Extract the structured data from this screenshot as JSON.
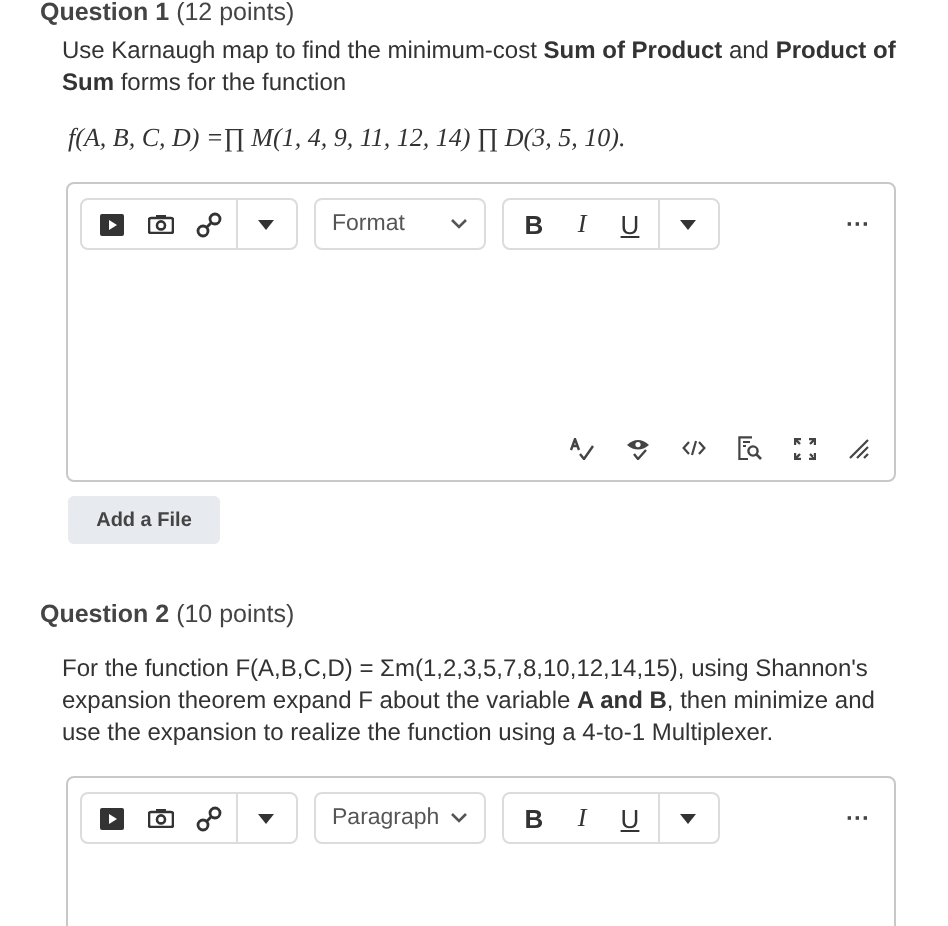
{
  "question_1": {
    "heading": "**Question 1** (12 points)",
    "prompt": "Use Karnaugh map to find the minimum-cost **Sum of Product** and **Product of Sum** forms for the function",
    "formula": "f(A, B, C, D) =∏ M(1, 4, 9, 11, 12, 14)  ∏ D(3, 5, 10).",
    "editor": {
      "format_label": "Format",
      "bold": "B",
      "italic": "I",
      "underline": "U",
      "more": "···",
      "show_status_bar": true
    },
    "add_file_button": "Add a File"
  },
  "question_2": {
    "heading": "**Question 2** (10 points)",
    "prompt": "For the function F(A,B,C,D) = Σm(1,2,3,5,7,8,10,12,14,15), using Shannon's expansion theorem expand F about the variable **A and B**, then minimize and use the expansion to realize the function using a 4-to-1 Multiplexer.",
    "editor": {
      "format_label": "Paragraph",
      "bold": "B",
      "italic": "I",
      "underline": "U",
      "more": "···",
      "show_status_bar": false
    }
  }
}
